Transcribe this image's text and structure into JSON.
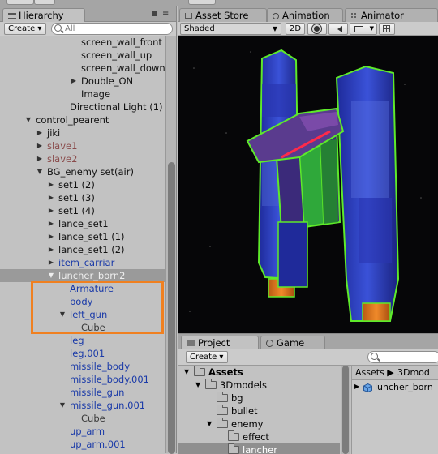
{
  "hierarchy": {
    "tab_label": "Hierarchy",
    "create_label": "Create ▾",
    "search_placeholder": "All",
    "rows": [
      {
        "label": "screen_wall_front",
        "style": "black",
        "arrow": ""
      },
      {
        "label": "screen_wall_up",
        "style": "black",
        "arrow": ""
      },
      {
        "label": "screen_wall_down",
        "style": "black",
        "arrow": ""
      },
      {
        "label": "Double_ON",
        "style": "black",
        "arrow": "▶"
      },
      {
        "label": "Image",
        "style": "black",
        "arrow": ""
      },
      {
        "label": "Directional Light (1)",
        "style": "black",
        "arrow": ""
      },
      {
        "label": "control_pearent",
        "style": "black",
        "arrow": "▼"
      },
      {
        "label": "jiki",
        "style": "black",
        "arrow": "▶"
      },
      {
        "label": "slave1",
        "style": "brown",
        "arrow": "▶"
      },
      {
        "label": "slave2",
        "style": "brown",
        "arrow": "▶"
      },
      {
        "label": "BG_enemy set(air)",
        "style": "black",
        "arrow": "▼"
      },
      {
        "label": "set1 (2)",
        "style": "black",
        "arrow": "▶"
      },
      {
        "label": "set1 (3)",
        "style": "black",
        "arrow": "▶"
      },
      {
        "label": "set1 (4)",
        "style": "black",
        "arrow": "▶"
      },
      {
        "label": "lance_set1",
        "style": "black",
        "arrow": "▶"
      },
      {
        "label": "lance_set1 (1)",
        "style": "black",
        "arrow": "▶"
      },
      {
        "label": "lance_set1 (2)",
        "style": "black",
        "arrow": "▶"
      },
      {
        "label": "item_carriar",
        "style": "prefab",
        "arrow": "▶"
      },
      {
        "label": "luncher_born2",
        "style": "selected",
        "arrow": "▼"
      },
      {
        "label": "Armature",
        "style": "prefab",
        "arrow": ""
      },
      {
        "label": "body",
        "style": "prefab",
        "arrow": ""
      },
      {
        "label": "left_gun",
        "style": "prefab",
        "arrow": "▼"
      },
      {
        "label": "Cube",
        "style": "gray",
        "arrow": ""
      },
      {
        "label": "leg",
        "style": "prefab",
        "arrow": ""
      },
      {
        "label": "leg.001",
        "style": "prefab",
        "arrow": ""
      },
      {
        "label": "missile_body",
        "style": "prefab",
        "arrow": ""
      },
      {
        "label": "missile_body.001",
        "style": "prefab",
        "arrow": ""
      },
      {
        "label": "missile_gun",
        "style": "prefab",
        "arrow": ""
      },
      {
        "label": "missile_gun.001",
        "style": "prefab",
        "arrow": "▼"
      },
      {
        "label": "Cube",
        "style": "gray",
        "arrow": ""
      },
      {
        "label": "up_arm",
        "style": "prefab",
        "arrow": ""
      },
      {
        "label": "up_arm.001",
        "style": "prefab",
        "arrow": ""
      }
    ]
  },
  "scene": {
    "tabs": [
      "Asset Store",
      "Animation",
      "Animator"
    ],
    "shading_label": "Shaded",
    "mode_2d_label": "2D"
  },
  "project": {
    "tabs": [
      "Project",
      "Game"
    ],
    "create_label": "Create ▾",
    "tree": [
      {
        "label": "Assets",
        "bold": true
      },
      {
        "label": "3Dmodels",
        "bold": false
      },
      {
        "label": "bg",
        "bold": false
      },
      {
        "label": "bullet",
        "bold": false
      },
      {
        "label": "enemy",
        "bold": false
      },
      {
        "label": "effect",
        "bold": false
      },
      {
        "label": "lancher",
        "bold": false
      }
    ],
    "breadcrumb_root": "Assets ▶",
    "breadcrumb_child": "3Dmod",
    "asset_item": "luncher_born"
  },
  "colors": {
    "highlight": "#f08020",
    "prefab_text": "#1a3aa8",
    "selection_outline": "#5eea2a"
  }
}
